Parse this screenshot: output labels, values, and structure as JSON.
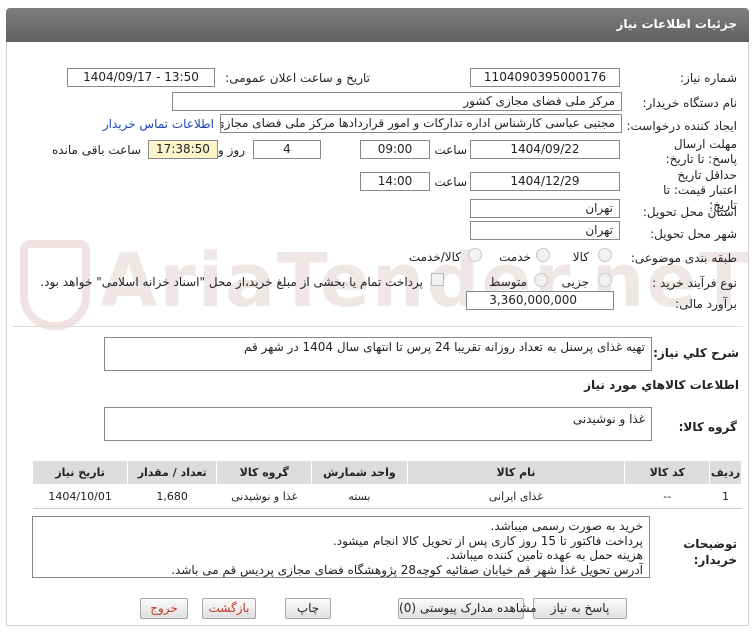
{
  "header": {
    "title": "جزئیات اطلاعات نیاز"
  },
  "watermark": {
    "text": "AriaTender.neT"
  },
  "labels": {
    "need_number": "شماره نیاز:",
    "announce_date": "تاریخ و ساعت اعلان عمومی:",
    "buyer_org": "نام دستگاه خریدار:",
    "requester": "ایجاد کننده درخواست:",
    "reply_deadline": "مهلت ارسال پاسخ: تا تاریخ:",
    "price_validity": "حداقل تاریخ اعتبار قیمت: تا تاریخ:",
    "time": "ساعت",
    "days_and": "روز و",
    "remaining": "ساعت باقی مانده",
    "province": "استان محل تحویل:",
    "city": "شهر محل تحویل:",
    "category": "طبقه بندی موضوعی:",
    "purchase_type": "نوع فرآیند خرید :",
    "estimate": "برآورد مالی:",
    "need_desc": "شرح کلي نياز:",
    "goods_info": "اطلاعات کالاهاي مورد نياز",
    "goods_group": "گروه کالا:",
    "buyer_notes": "توضیحات خریدار:"
  },
  "fields": {
    "need_number": "1104090395000176",
    "announce_datetime": "1404/09/17 - 13:50",
    "buyer_org": "مرکز ملی فضای مجازی کشور",
    "requester": "مجتبی عباسی کارشناس اداره تدارکات و امور قراردادها مرکز ملی فضای مجازی",
    "contact_link": "اطلاعات تماس خریدار",
    "reply_date": "1404/09/22",
    "reply_time": "09:00",
    "reply_days": "4",
    "reply_remaining": "17:38:50",
    "validity_date": "1404/12/29",
    "validity_time": "14:00",
    "province": "تهران",
    "city": "تهران",
    "estimate": "3,360,000,000",
    "need_desc": "تهیه غذای پرسنل به تعداد روزانه تقریبا 24 پرس تا انتهای سال 1404 در شهر قم",
    "goods_group": "غذا و نوشیدنی"
  },
  "category_options": [
    "کالا",
    "خدمت",
    "کالا/خدمت"
  ],
  "purchase_options": [
    "جزیی",
    "متوسط"
  ],
  "payment_note": "پرداخت تمام یا بخشی از مبلغ خرید،از محل \"اسناد خزانه اسلامی\" خواهد بود.",
  "table": {
    "headers": [
      "ردیف",
      "کد کالا",
      "نام کالا",
      "واحد شمارش",
      "گروه کالا",
      "تعداد / مقدار",
      "تاریخ نیاز"
    ],
    "rows": [
      [
        "1",
        "--",
        "غذای ایرانی",
        "بسته",
        "غذا و نوشیدنی",
        "1,680",
        "1404/10/01"
      ]
    ]
  },
  "notes_lines": [
    "خرید به صورت رسمی میباشد.",
    "پرداخت فاکتور تا 15 روز کاری پس از تحویل کالا انجام میشود.",
    "هزینه حمل به عهده تامین کننده میباشد.",
    "آدرس تحویل غذا شهر قم خیابان صفائیه کوچه28 پژوهشگاه فضای مجازی پردیس قم می باشد."
  ],
  "buttons": {
    "reply": "پاسخ به نیاز",
    "attachments": "مشاهده مدارک پیوستی (0)",
    "print": "چاپ",
    "back": "بازگشت",
    "exit": "خروج"
  }
}
